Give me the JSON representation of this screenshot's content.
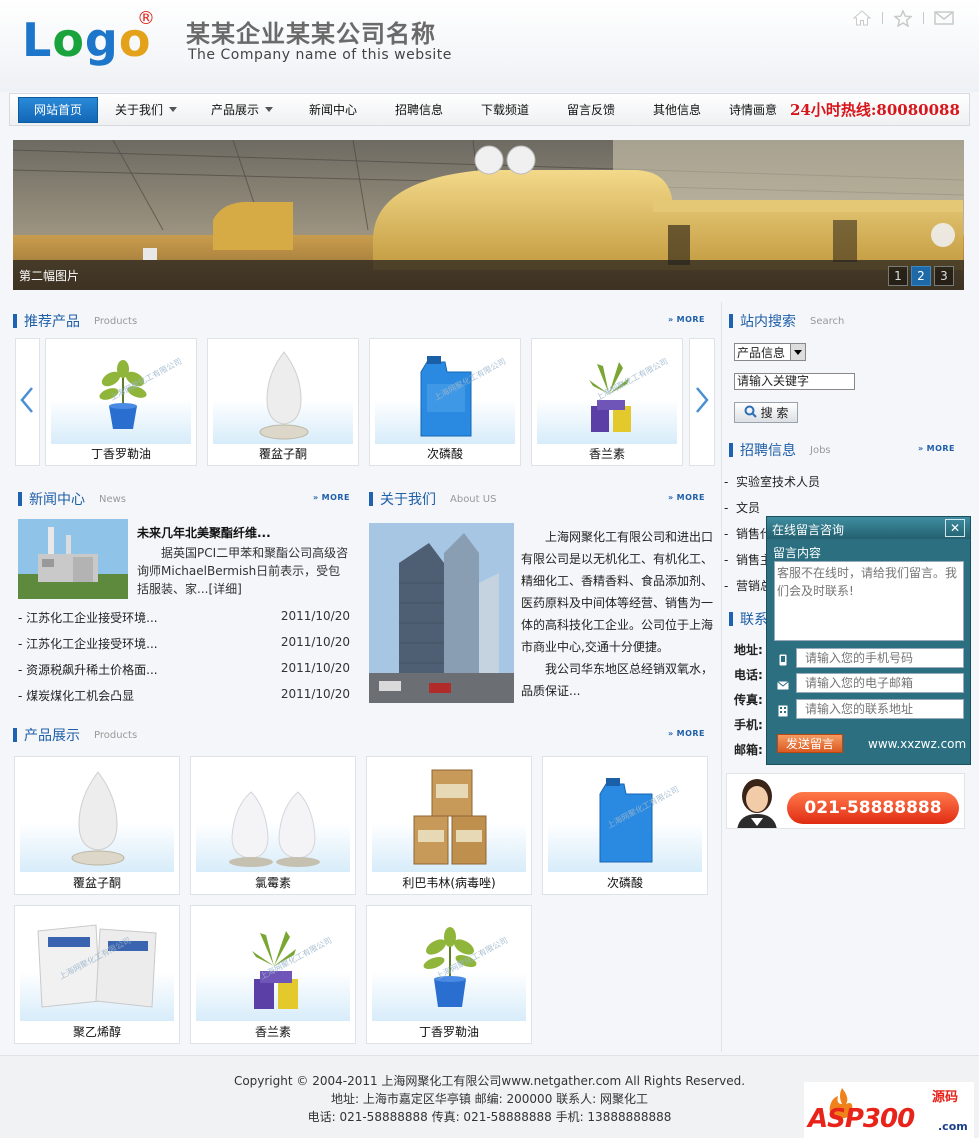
{
  "header": {
    "logo_text": "Logo",
    "logo_mark": "®",
    "company_cn": "某某企业某某公司名称",
    "company_en": "The Company name of this  website",
    "icons": [
      "home-icon",
      "star-icon",
      "mail-icon"
    ]
  },
  "nav": {
    "items": [
      {
        "label": "网站首页",
        "active": true
      },
      {
        "label": "关于我们",
        "dropdown": true
      },
      {
        "label": "产品展示",
        "dropdown": true
      },
      {
        "label": "新闻中心"
      },
      {
        "label": "招聘信息"
      },
      {
        "label": "下载频道"
      },
      {
        "label": "留言反馈"
      },
      {
        "label": "其他信息"
      },
      {
        "label": "诗情画意"
      }
    ],
    "hotline": "24小时热线:80080088"
  },
  "banner": {
    "caption": "第二幅图片",
    "pages": [
      "1",
      "2",
      "3"
    ],
    "active_page": "2"
  },
  "recommended": {
    "title": "推荐产品",
    "subtitle": "Products",
    "more": "MORE",
    "items": [
      "丁香罗勒油",
      "覆盆子酮",
      "次磷酸",
      "香兰素"
    ]
  },
  "news": {
    "title": "新闻中心",
    "subtitle": "News",
    "more": "MORE",
    "featured_title": "未来几年北美聚酯纤维...",
    "featured_summary": "据英国PCI二甲苯和聚酯公司高级咨询师MichaelBermish日前表示，受包括服装、家...",
    "featured_link": "[详细]",
    "items": [
      {
        "title": "- 江苏化工企业接受环境...",
        "date": "2011/10/20"
      },
      {
        "title": "- 江苏化工企业接受环境...",
        "date": "2011/10/20"
      },
      {
        "title": "- 资源税飙升稀土价格面...",
        "date": "2011/10/20"
      },
      {
        "title": "- 煤炭煤化工机会凸显",
        "date": "2011/10/20"
      }
    ]
  },
  "about": {
    "title": "关于我们",
    "subtitle": "About US",
    "more": "MORE",
    "paragraph1": "上海网聚化工有限公司和进出口有限公司是以无机化工、有机化工、精细化工、香精香料、食品添加剂、医药原料及中间体等经营、销售为一体的高科技化工企业。公司位于上海市商业中心,交通十分便捷。",
    "paragraph2": "我公司华东地区总经销双氧水，品质保证..."
  },
  "products": {
    "title": "产品展示",
    "subtitle": "Products",
    "more": "MORE",
    "items": [
      "覆盆子酮",
      "氯霉素",
      "利巴韦林(病毒唑)",
      "次磷酸",
      "聚乙烯醇",
      "香兰素",
      "丁香罗勒油"
    ]
  },
  "search": {
    "title": "站内搜索",
    "subtitle": "Search",
    "select_value": "产品信息",
    "input_value": "请输入关键字",
    "button": "搜 索"
  },
  "jobs": {
    "title": "招聘信息",
    "subtitle": "Jobs",
    "more": "MORE",
    "items": [
      "实验室技术人员",
      "文员",
      "销售代",
      "销售主",
      "营销总"
    ]
  },
  "contact": {
    "title_partial": "联系",
    "labels": [
      "地址:",
      "电话:",
      "传真:",
      "手机:",
      "邮箱:"
    ],
    "phone_banner": "021-58888888"
  },
  "chat": {
    "title": "在线留言咨询",
    "close": "✕",
    "content_label": "留言内容",
    "textarea_placeholder": "客服不在线时，请给我们留言。我们会及时联系!",
    "phone_placeholder": "请输入您的手机号码",
    "email_placeholder": "请输入您的电子邮箱",
    "address_placeholder": "请输入您的联系地址",
    "send": "发送留言",
    "site": "www.xxzwz.com"
  },
  "footer": {
    "line1": "Copyright © 2004-2011 上海网聚化工有限公司www.netgather.com All Rights Reserved.",
    "line2": "地址: 上海市嘉定区华亭镇   邮编: 200000   联系人: 网聚化工",
    "line3": "电话: 021-58888888   传真: 021-58888888   手机: 13888888888",
    "badge_main": "ASP300",
    "badge_sub": "源码",
    "badge_domain": ".com"
  },
  "colors": {
    "brand_blue": "#1f5fa8",
    "hotline_red": "#d7151a",
    "chat_teal": "#2b6f81"
  }
}
